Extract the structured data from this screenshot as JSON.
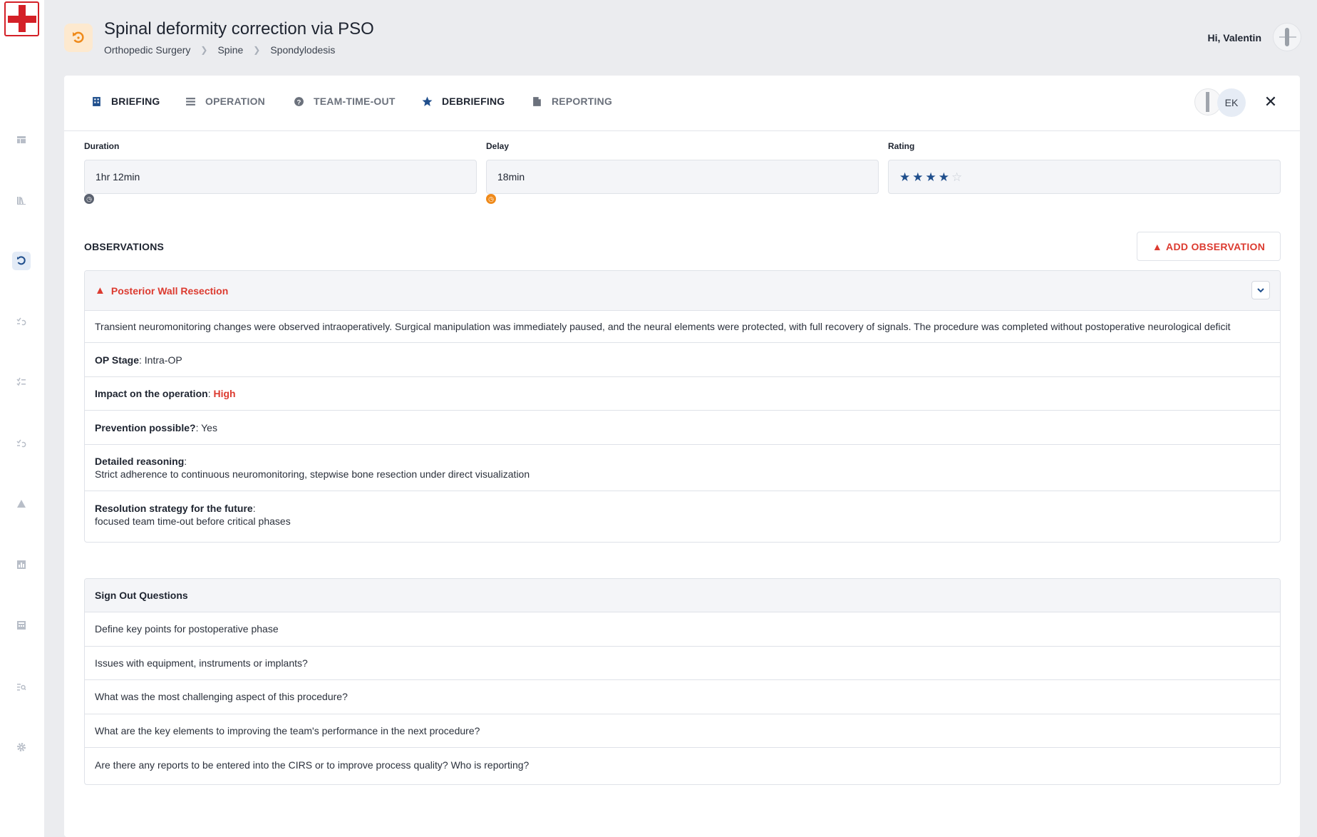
{
  "header": {
    "title": "Spinal deformity correction via PSO",
    "breadcrumb": [
      "Orthopedic Surgery",
      "Spine",
      "Spondylodesis"
    ],
    "greeting": "Hi, Valentin"
  },
  "sidebar": {
    "icons": [
      "table-icon",
      "books-icon",
      "debriefing-icon",
      "checklist-undo-icon",
      "checklist-icon",
      "checklist-undo-icon",
      "warning-icon",
      "chart-icon",
      "calculator-icon",
      "search-list-icon",
      "gear-icon"
    ],
    "active_index": 2
  },
  "tabs": [
    {
      "label": "BRIEFING",
      "icon": "building-icon",
      "active": false
    },
    {
      "label": "OPERATION",
      "icon": "list-icon",
      "active": false
    },
    {
      "label": "TEAM-TIME-OUT",
      "icon": "question-icon",
      "active": false
    },
    {
      "label": "DEBRIEFING",
      "icon": "star-icon",
      "active": true
    },
    {
      "label": "REPORTING",
      "icon": "document-icon",
      "active": false
    }
  ],
  "team": {
    "initials": "EK"
  },
  "fields": {
    "duration": {
      "label": "Duration",
      "value": "1hr 12min"
    },
    "delay": {
      "label": "Delay",
      "value": "18min"
    },
    "rating": {
      "label": "Rating",
      "value": 4,
      "max": 5
    }
  },
  "observations": {
    "title": "OBSERVATIONS",
    "add_label": "ADD OBSERVATION",
    "item": {
      "title": "Posterior Wall Resection",
      "description": "Transient neuromonitoring changes were observed intraoperatively. Surgical manipulation was immediately paused, and the neural elements were protected, with full recovery of signals. The procedure was completed without postoperative neurological deficit",
      "op_stage_label": "OP Stage",
      "op_stage": "Intra-OP",
      "impact_label": "Impact on the operation",
      "impact": "High",
      "prevention_label": "Prevention possible?",
      "prevention": "Yes",
      "reasoning_label": "Detailed reasoning",
      "reasoning": "Strict adherence to continuous neuromonitoring, stepwise bone resection under direct visualization",
      "resolution_label": "Resolution strategy for the future",
      "resolution": "focused team time-out before critical phases"
    }
  },
  "signout": {
    "title": "Sign Out Questions",
    "questions": [
      "Define key points for postoperative phase",
      "Issues with equipment, instruments or implants?",
      "What was the most challenging aspect of this procedure?",
      "What are the key elements to improving the team's performance in the next procedure?",
      "Are there any reports to be entered into the CIRS or to improve process quality? Who is reporting?"
    ]
  },
  "colors": {
    "accent": "#1f4e8c",
    "warning": "#dc3b30",
    "page_icon": "#ef8a1a",
    "logo": "#d42027"
  }
}
